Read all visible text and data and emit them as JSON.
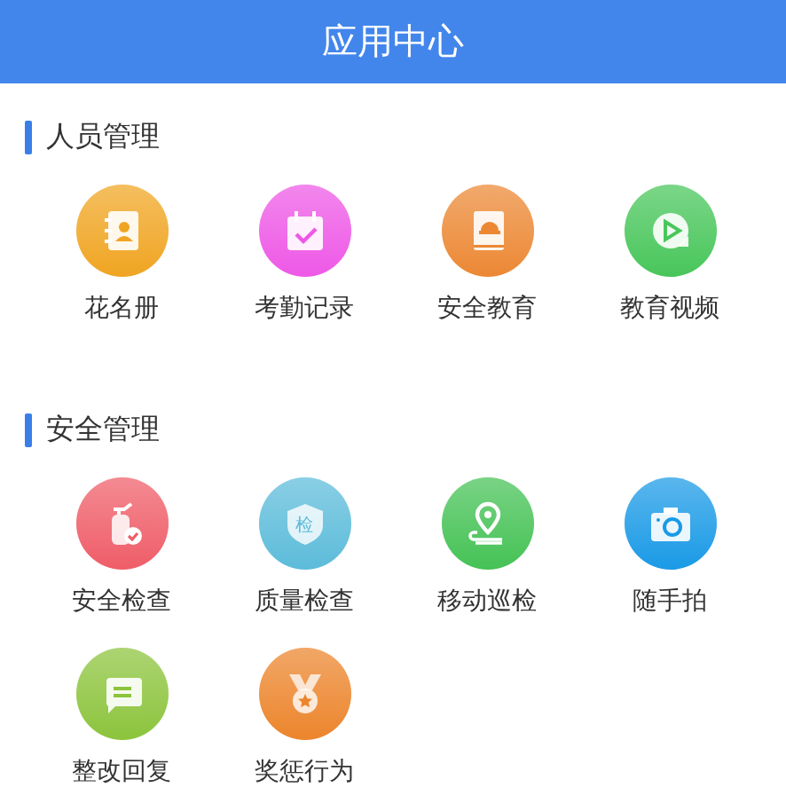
{
  "header": {
    "title": "应用中心"
  },
  "sections": [
    {
      "title": "人员管理",
      "items": [
        {
          "label": "花名册",
          "kind": "contacts",
          "color": "#f0a522"
        },
        {
          "label": "考勤记录",
          "kind": "calendar",
          "color": "#ee58e6"
        },
        {
          "label": "安全教育",
          "kind": "book",
          "color": "#ec8834"
        },
        {
          "label": "教育视频",
          "kind": "video",
          "color": "#48c65a"
        }
      ]
    },
    {
      "title": "安全管理",
      "items": [
        {
          "label": "安全检查",
          "kind": "extinguisher",
          "color": "#ef5d68"
        },
        {
          "label": "质量检查",
          "kind": "shield",
          "color": "#5cbcda",
          "icon_text": "检"
        },
        {
          "label": "移动巡检",
          "kind": "pin",
          "color": "#45c255"
        },
        {
          "label": "随手拍",
          "kind": "camera",
          "color": "#1a9ae6"
        },
        {
          "label": "整改回复",
          "kind": "message",
          "color": "#8cc43c"
        },
        {
          "label": "奖惩行为",
          "kind": "medal",
          "color": "#ec852c"
        }
      ]
    }
  ]
}
